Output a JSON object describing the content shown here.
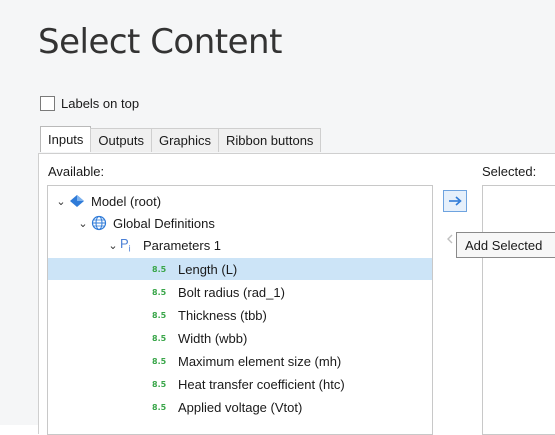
{
  "title": "Select Content",
  "labels_on_top": {
    "label": "Labels on top",
    "checked": false
  },
  "tabs": [
    {
      "label": "Inputs",
      "active": true
    },
    {
      "label": "Outputs",
      "active": false
    },
    {
      "label": "Graphics",
      "active": false
    },
    {
      "label": "Ribbon buttons",
      "active": false
    }
  ],
  "available_label": "Available:",
  "selected_label": "Selected:",
  "tree": {
    "model": "Model (root)",
    "global_definitions": "Global Definitions",
    "parameters": "Parameters 1",
    "parameter_badge": "8.5",
    "parameters_icon": "P",
    "parameters_icon_sub": "i",
    "items": [
      {
        "label": "Length (L)",
        "selected": true
      },
      {
        "label": "Bolt radius (rad_1)",
        "selected": false
      },
      {
        "label": "Thickness (tbb)",
        "selected": false
      },
      {
        "label": "Width (wbb)",
        "selected": false
      },
      {
        "label": "Maximum element size (mh)",
        "selected": false
      },
      {
        "label": "Heat transfer coefficient (htc)",
        "selected": false
      },
      {
        "label": "Applied voltage (Vtot)",
        "selected": false
      }
    ]
  },
  "tooltip": "Add Selected",
  "colors": {
    "selection": "#cce4f7",
    "accent": "#2f7bd8",
    "param_icon": "#3aa64a"
  }
}
